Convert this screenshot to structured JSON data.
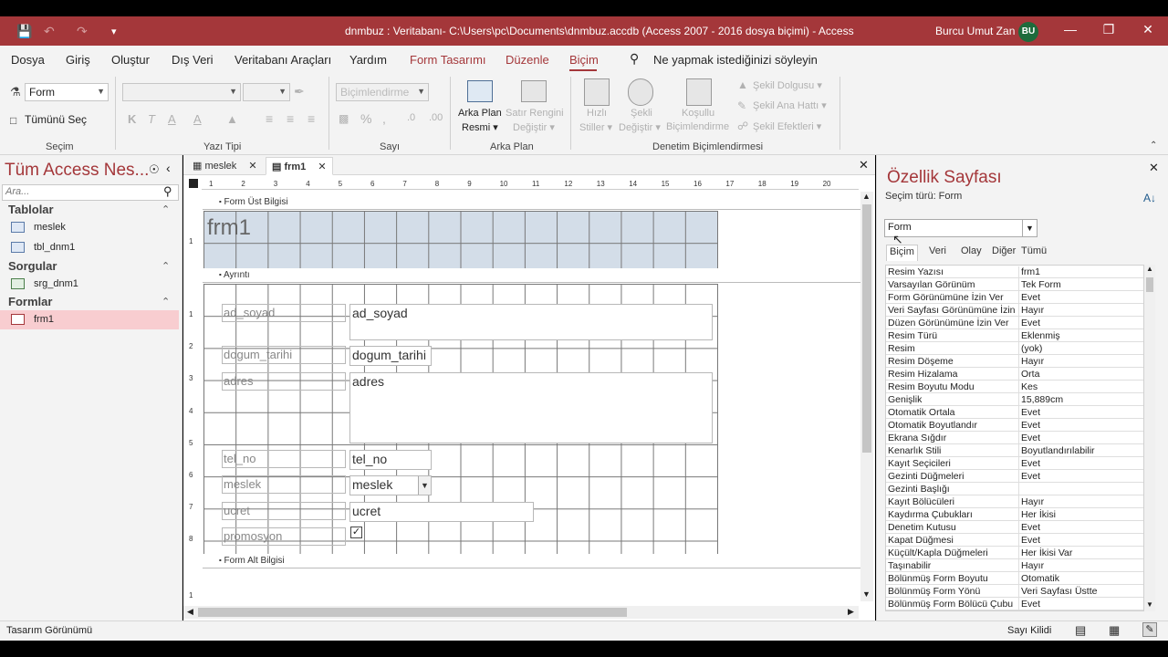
{
  "window": {
    "title": "dnmbuz : Veritabanı- C:\\Users\\pc\\Documents\\dnmbuz.accdb (Access 2007 - 2016 dosya biçimi)  -  Access",
    "user_name": "Burcu Umut Zan",
    "user_initials": "BU",
    "accent_color": "#a4373a"
  },
  "menu": {
    "items": [
      "Dosya",
      "Giriş",
      "Oluştur",
      "Dış Veri",
      "Veritabanı Araçları",
      "Yardım",
      "Form Tasarımı",
      "Düzenle",
      "Biçim"
    ],
    "active": "Biçim",
    "tell_me": "Ne yapmak istediğinizi söyleyin"
  },
  "ribbon": {
    "selection_combo": "Form",
    "select_all": "Tümünü Seç",
    "font_combo": "",
    "size_combo": "",
    "format_combo": "Biçimlendirme",
    "bg_image": [
      "Arka Plan",
      "Resmi ▾"
    ],
    "alt_row": [
      "Satır Rengini",
      "Değiştir ▾"
    ],
    "quick_styles": [
      "Hızlı",
      "Stiller ▾"
    ],
    "change_shape": [
      "Şekli",
      "Değiştir ▾"
    ],
    "conditional": [
      "Koşullu",
      "Biçimlendirme"
    ],
    "shape_fill": "Şekil Dolgusu ▾",
    "shape_outline": "Şekil Ana Hattı ▾",
    "shape_effects": "Şekil Efektleri ▾",
    "groups": {
      "selection": "Seçim",
      "font": "Yazı Tipi",
      "number": "Sayı",
      "background": "Arka Plan",
      "control_format": "Denetim Biçimlendirmesi"
    }
  },
  "nav": {
    "title": "Tüm Access Nes...",
    "search_placeholder": "Ara...",
    "groups": [
      {
        "label": "Tablolar",
        "items": [
          "meslek",
          "tbl_dnm1"
        ]
      },
      {
        "label": "Sorgular",
        "items": [
          "srg_dnm1"
        ]
      },
      {
        "label": "Formlar",
        "items": [
          "frm1"
        ]
      }
    ],
    "selected": "frm1"
  },
  "tabs": {
    "items": [
      "meslek",
      "frm1"
    ],
    "active": "frm1"
  },
  "design": {
    "header_section": "Form Üst Bilgisi",
    "detail_section": "Ayrıntı",
    "footer_section": "Form Alt Bilgisi",
    "form_title": "frm1",
    "ruler_h": [
      "1",
      "2",
      "3",
      "4",
      "5",
      "6",
      "7",
      "8",
      "9",
      "10",
      "11",
      "12",
      "13",
      "14",
      "15",
      "16",
      "17",
      "18",
      "19",
      "20"
    ],
    "ruler_v_header": [
      "1"
    ],
    "ruler_v_detail": [
      "1",
      "2",
      "3",
      "4",
      "5",
      "6",
      "7",
      "8"
    ],
    "ruler_v_footer": [
      "1"
    ],
    "fields": {
      "ad_soyad": {
        "label": "ad_soyad",
        "control": "ad_soyad"
      },
      "dogum_tarihi": {
        "label": "dogum_tarihi",
        "control": "dogum_tarihi"
      },
      "adres": {
        "label": "adres",
        "control": "adres"
      },
      "tel_no": {
        "label": "tel_no",
        "control": "tel_no"
      },
      "meslek": {
        "label": "meslek",
        "control": "meslek"
      },
      "ucret": {
        "label": "ucret",
        "control": "ucret"
      },
      "promosyon": {
        "label": "promosyon",
        "checked": true
      }
    }
  },
  "props": {
    "title": "Özellik Sayfası",
    "selection_type": "Seçim türü:  Form",
    "object_combo": "Form",
    "tabs": [
      "Biçim",
      "Veri",
      "Olay",
      "Diğer",
      "Tümü"
    ],
    "active_tab": "Biçim",
    "rows": [
      {
        "k": "Resim Yazısı",
        "v": "frm1"
      },
      {
        "k": "Varsayılan Görünüm",
        "v": "Tek Form"
      },
      {
        "k": "Form Görünümüne İzin Ver",
        "v": "Evet"
      },
      {
        "k": "Veri Sayfası Görünümüne İzin",
        "v": "Hayır"
      },
      {
        "k": "Düzen Görünümüne İzin Ver",
        "v": "Evet"
      },
      {
        "k": "Resim Türü",
        "v": "Eklenmiş"
      },
      {
        "k": "Resim",
        "v": "(yok)"
      },
      {
        "k": "Resim Döşeme",
        "v": "Hayır"
      },
      {
        "k": "Resim Hizalama",
        "v": "Orta"
      },
      {
        "k": "Resim Boyutu Modu",
        "v": "Kes"
      },
      {
        "k": "Genişlik",
        "v": "15,889cm"
      },
      {
        "k": "Otomatik Ortala",
        "v": "Evet"
      },
      {
        "k": "Otomatik Boyutlandır",
        "v": "Evet"
      },
      {
        "k": "Ekrana Sığdır",
        "v": "Evet"
      },
      {
        "k": "Kenarlık Stili",
        "v": "Boyutlandırılabilir"
      },
      {
        "k": "Kayıt Seçicileri",
        "v": "Evet"
      },
      {
        "k": "Gezinti Düğmeleri",
        "v": "Evet"
      },
      {
        "k": "Gezinti Başlığı",
        "v": ""
      },
      {
        "k": "Kayıt Bölücüleri",
        "v": "Hayır"
      },
      {
        "k": "Kaydırma Çubukları",
        "v": "Her İkisi"
      },
      {
        "k": "Denetim Kutusu",
        "v": "Evet"
      },
      {
        "k": "Kapat Düğmesi",
        "v": "Evet"
      },
      {
        "k": "Küçült/Kapla Düğmeleri",
        "v": "Her İkisi Var"
      },
      {
        "k": "Taşınabilir",
        "v": "Hayır"
      },
      {
        "k": "Bölünmüş Form Boyutu",
        "v": "Otomatik"
      },
      {
        "k": "Bölünmüş Form Yönü",
        "v": "Veri Sayfası Üstte"
      },
      {
        "k": "Bölünmüş Form Bölücü Çubu",
        "v": "Evet"
      }
    ]
  },
  "status": {
    "left": "Tasarım Görünümü",
    "right": "Sayı Kilidi"
  }
}
